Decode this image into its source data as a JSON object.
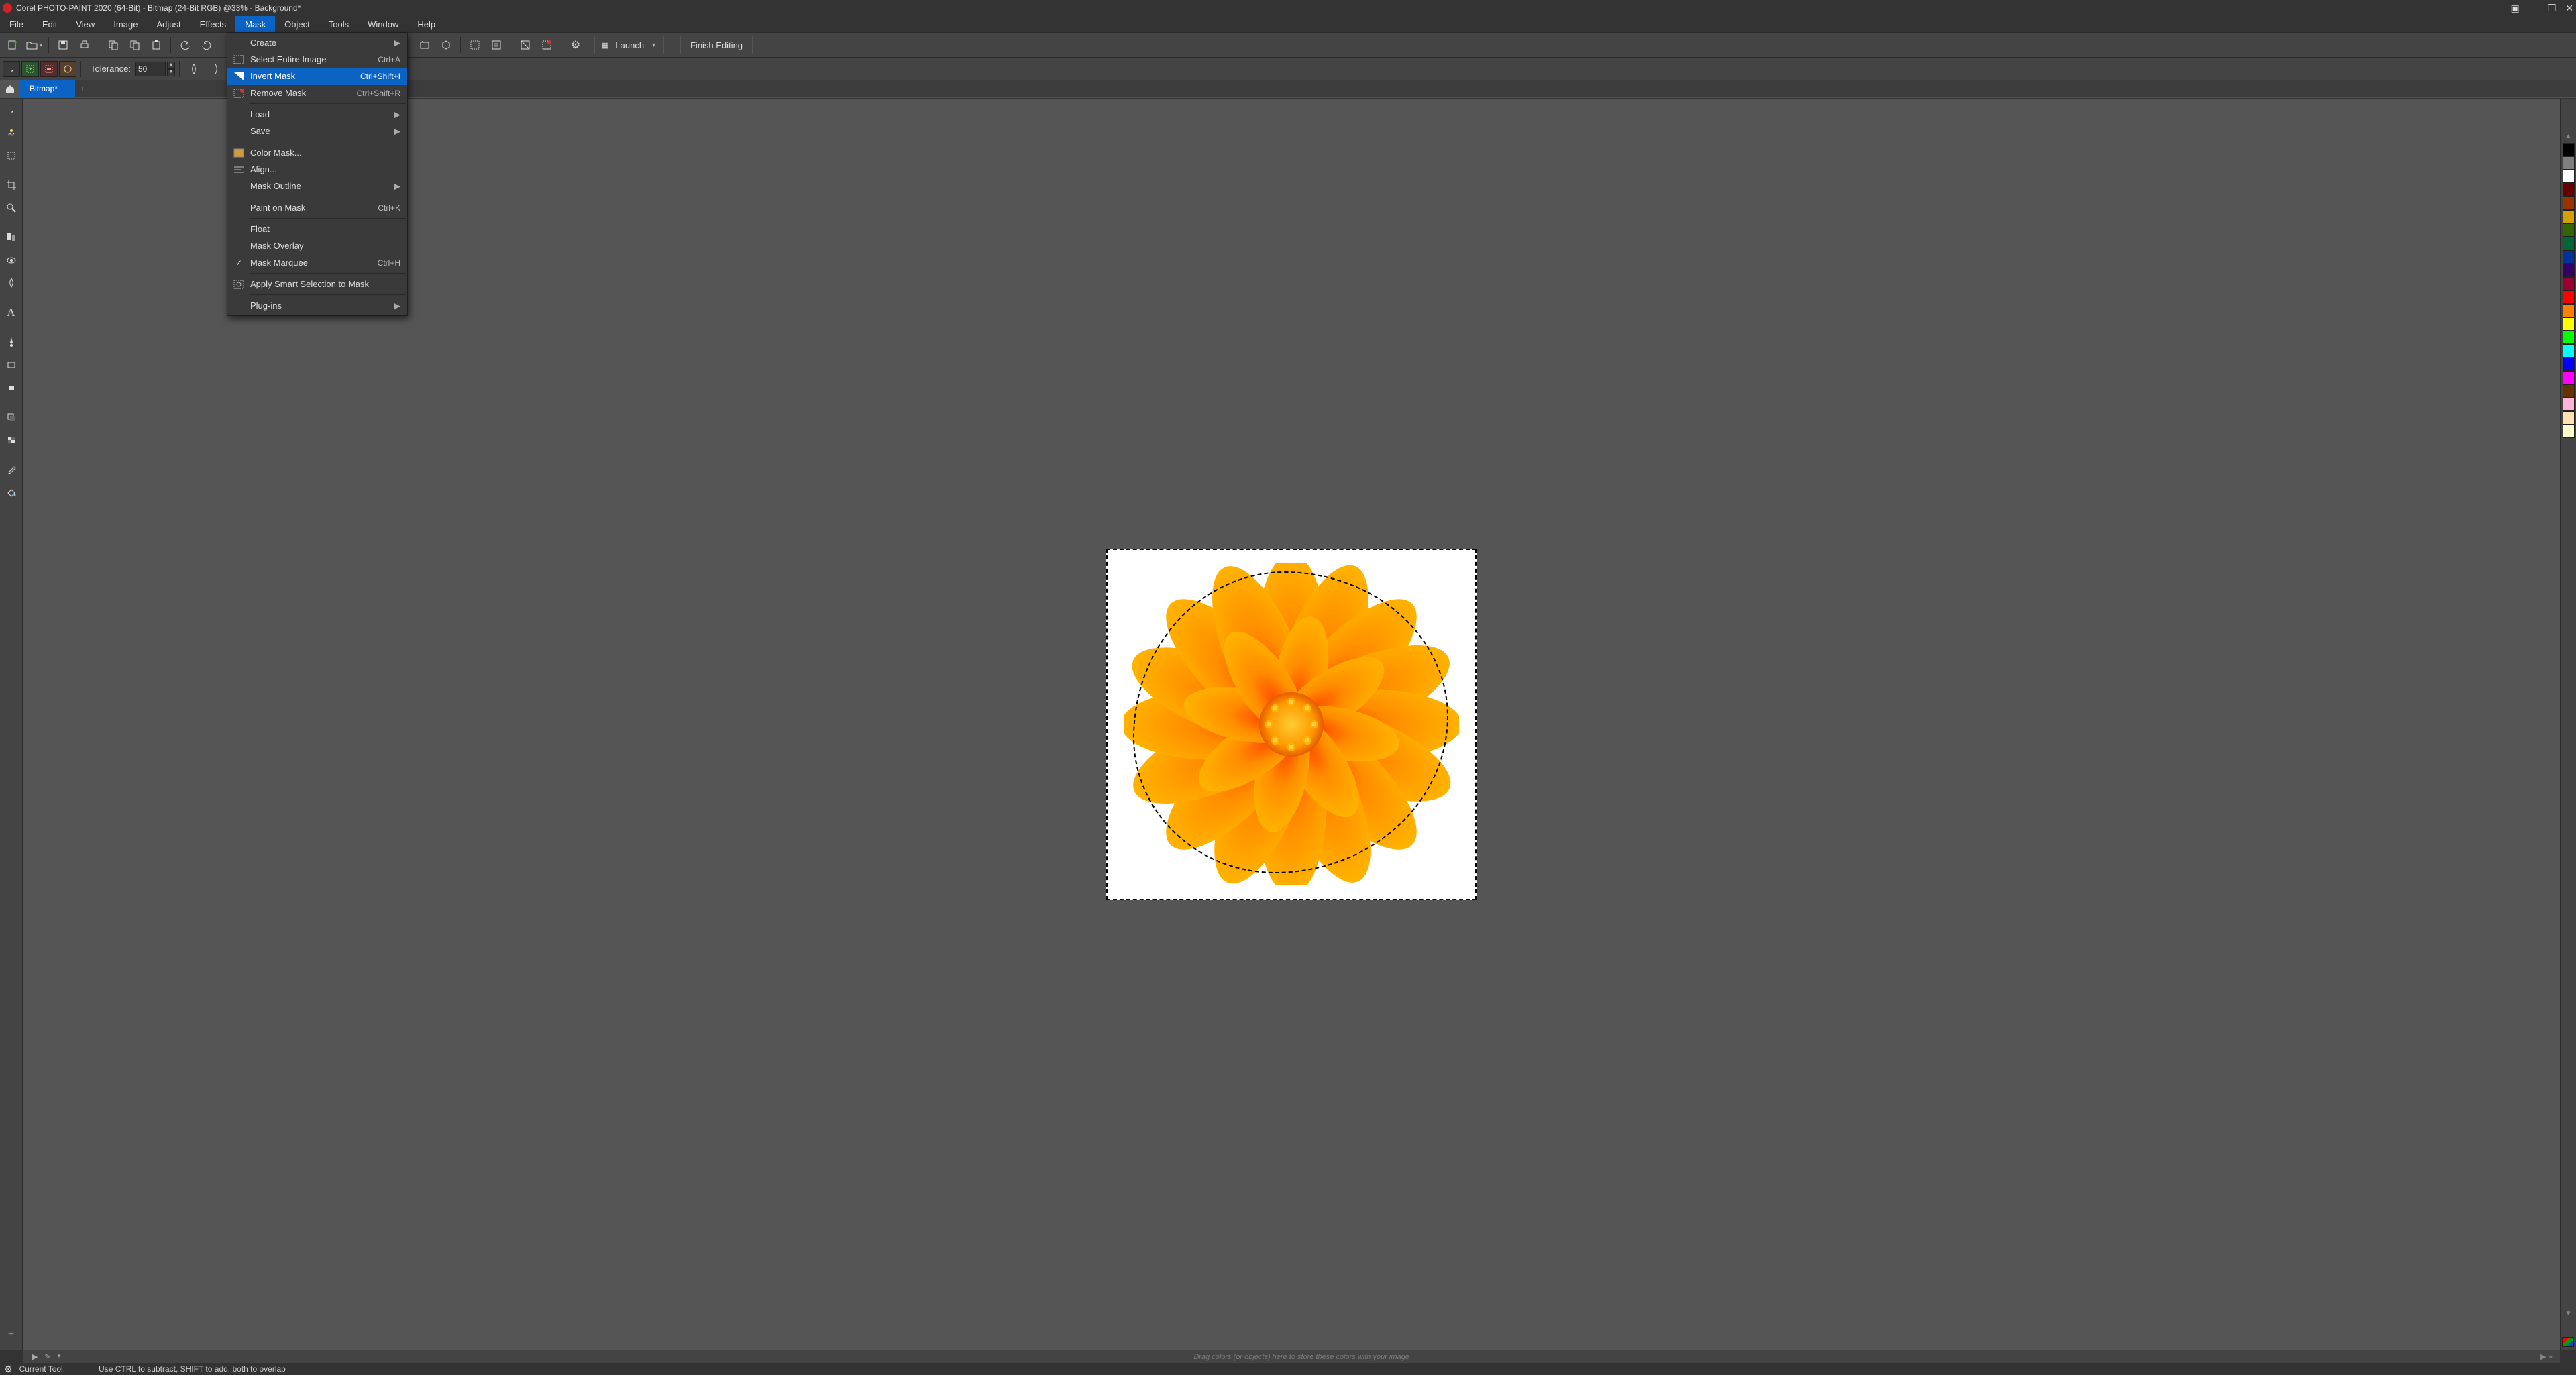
{
  "title": "Corel PHOTO-PAINT 2020 (64-Bit) - Bitmap (24-Bit RGB) @33% - Background*",
  "menubar": [
    "File",
    "Edit",
    "View",
    "Image",
    "Adjust",
    "Effects",
    "Mask",
    "Object",
    "Tools",
    "Window",
    "Help"
  ],
  "active_menu_index": 6,
  "toolbar": {
    "launch_label": "Launch",
    "finish_label": "Finish Editing"
  },
  "propbar": {
    "tolerance_label": "Tolerance:",
    "tolerance_value": "50"
  },
  "tabs": {
    "home_icon": "home-icon",
    "doc_label": "Bitmap*"
  },
  "tray_hint": "Drag colors (or objects) here to store these colors with your image",
  "status": {
    "label": "Current Tool:",
    "hint": "Use CTRL to subtract, SHIFT to add, both to overlap"
  },
  "dropdown": {
    "items": [
      {
        "label": "Create",
        "submenu": true
      },
      {
        "label": "Select Entire Image",
        "shortcut": "Ctrl+A",
        "icon": "select-all-icon"
      },
      {
        "label": "Invert Mask",
        "shortcut": "Ctrl+Shift+I",
        "icon": "invert-mask-icon",
        "highlight": true
      },
      {
        "label": "Remove Mask",
        "shortcut": "Ctrl+Shift+R",
        "icon": "remove-mask-icon"
      },
      {
        "sep": true
      },
      {
        "label": "Load",
        "submenu": true
      },
      {
        "label": "Save",
        "submenu": true
      },
      {
        "sep": true
      },
      {
        "label": "Color Mask...",
        "icon": "color-mask-icon"
      },
      {
        "label": "Align...",
        "icon": "align-icon"
      },
      {
        "label": "Mask Outline",
        "submenu": true
      },
      {
        "sep": true
      },
      {
        "label": "Paint on Mask",
        "shortcut": "Ctrl+K"
      },
      {
        "sep": true
      },
      {
        "label": "Float"
      },
      {
        "label": "Mask Overlay"
      },
      {
        "label": "Mask Marquee",
        "shortcut": "Ctrl+H",
        "checked": true
      },
      {
        "sep": true
      },
      {
        "label": "Apply Smart Selection to Mask",
        "icon": "smart-select-icon"
      },
      {
        "sep": true
      },
      {
        "label": "Plug-ins",
        "submenu": true
      }
    ]
  },
  "color_swatches": [
    "#000000",
    "#7f7f7f",
    "#ffffff",
    "#660000",
    "#993300",
    "#d4a000",
    "#336600",
    "#006633",
    "#003399",
    "#330066",
    "#990033",
    "#ff0000",
    "#ff8000",
    "#ffff00",
    "#00ff00",
    "#00ffff",
    "#0000ff",
    "#ff00ff",
    "#663300",
    "#ffb3d9",
    "#ffe0b3",
    "#ffffcc"
  ],
  "corner_swatch": "linear-gradient(135deg,#ff0000 0 33%,#00a000 33% 66%,#0040ff 66%)"
}
